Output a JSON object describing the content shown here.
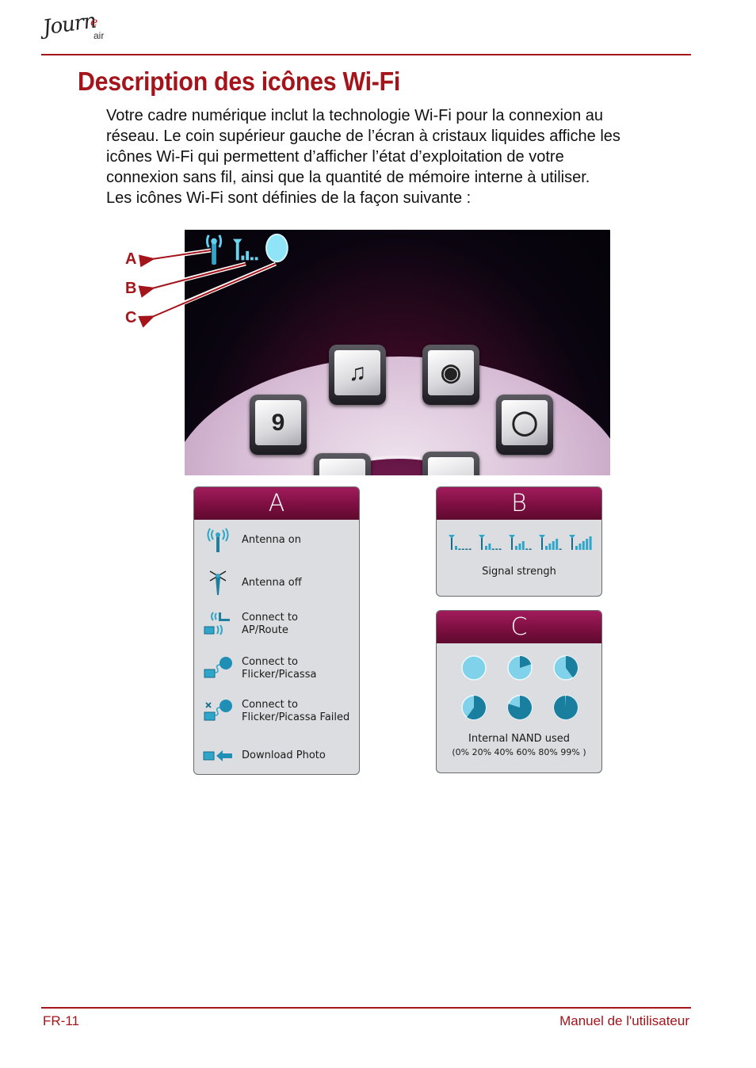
{
  "header": {
    "logo_script": "Journ",
    "logo_accent": "e",
    "logo_suffix": "air"
  },
  "title": "Description des icônes Wi-Fi",
  "intro_lines": [
    "Votre cadre numérique inclut la technologie Wi-Fi pour la connexion au",
    "réseau. Le coin supérieur gauche de l’écran à cristaux liquides affiche les",
    "icônes Wi-Fi qui permettent d’afficher l’état d’exploitation de votre",
    "connexion sans fil, ainsi que la quantité de mémoire interne à utiliser.",
    "Les icônes Wi-Fi sont définies de la façon suivante :"
  ],
  "screen": {
    "callouts": [
      "A",
      "B",
      "C"
    ],
    "status_icons": [
      "antenna-icon",
      "signal-strength-icon",
      "memory-usage-icon"
    ],
    "menu_tiles": [
      {
        "icon": "calendar-icon",
        "text": "9"
      },
      {
        "icon": "photo-music-icon",
        "text": ""
      },
      {
        "icon": "video-camera-icon",
        "text": ""
      },
      {
        "icon": "speaker-icon",
        "text": ""
      },
      {
        "icon": "settings-icon",
        "text": ""
      },
      {
        "icon": "weather-icon",
        "text": ""
      }
    ]
  },
  "panels": {
    "a": {
      "heading": "A",
      "items": [
        {
          "icon": "antenna-on-icon",
          "label": "Antenna on"
        },
        {
          "icon": "antenna-off-icon",
          "label": "Antenna off"
        },
        {
          "icon": "connect-ap-icon",
          "label": "Connect to\nAP/Route"
        },
        {
          "icon": "connect-online-icon",
          "label": "Connect to\nFlicker/Picassa"
        },
        {
          "icon": "connect-failed-icon",
          "label": "Connect to\nFlicker/Picassa Failed"
        },
        {
          "icon": "download-photo-icon",
          "label": "Download Photo"
        }
      ]
    },
    "b": {
      "heading": "B",
      "signal_levels": [
        1,
        2,
        3,
        4,
        5
      ],
      "signal_max": 5,
      "caption": "Signal strengh"
    },
    "c": {
      "heading": "C",
      "usage_levels": [
        0,
        20,
        40,
        60,
        80,
        99
      ],
      "caption": "Internal NAND used",
      "subcaption": "(0% 20% 40% 60% 80% 99% )"
    }
  },
  "colors": {
    "accent": "#a4141b",
    "panel_header": "#8a1248",
    "icon_blue": "#2fa6c9",
    "icon_dark": "#136d8a"
  },
  "footer": {
    "page": "FR-11",
    "manual": "Manuel de l'utilisateur"
  }
}
